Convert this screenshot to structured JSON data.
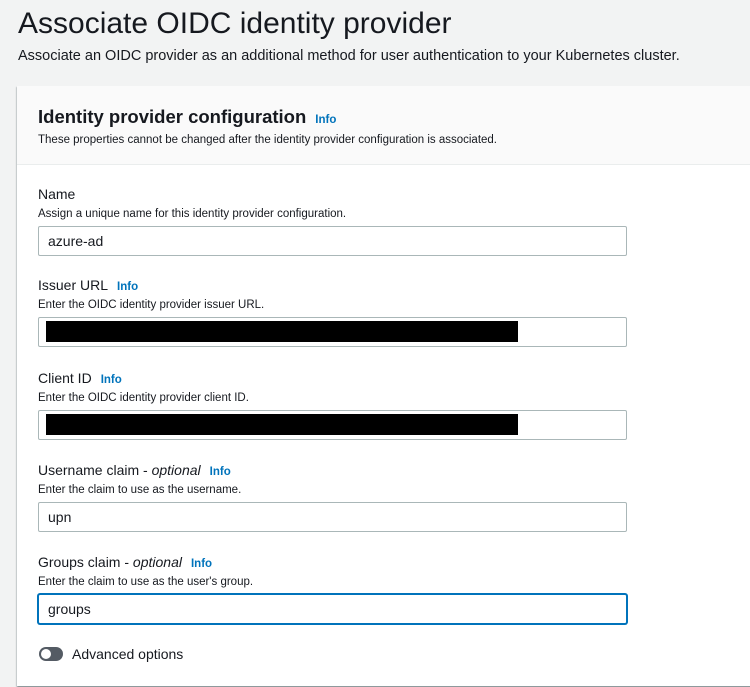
{
  "page": {
    "title": "Associate OIDC identity provider",
    "description": "Associate an OIDC provider as an additional method for user authentication to your Kubernetes cluster."
  },
  "panel": {
    "title": "Identity provider configuration",
    "info_label": "Info",
    "subtitle": "These properties cannot be changed after the identity provider configuration is associated."
  },
  "fields": {
    "name": {
      "label": "Name",
      "description": "Assign a unique name for this identity provider configuration.",
      "value": "azure-ad"
    },
    "issuer_url": {
      "label": "Issuer URL",
      "info_label": "Info",
      "description": "Enter the OIDC identity provider issuer URL.",
      "value": ""
    },
    "client_id": {
      "label": "Client ID",
      "info_label": "Info",
      "description": "Enter the OIDC identity provider client ID.",
      "value": ""
    },
    "username_claim": {
      "label": "Username claim - ",
      "optional": "optional",
      "info_label": "Info",
      "description": "Enter the claim to use as the username.",
      "value": "upn"
    },
    "groups_claim": {
      "label": "Groups claim - ",
      "optional": "optional",
      "info_label": "Info",
      "description": "Enter the claim to use as the user's group.",
      "value": "groups"
    }
  },
  "advanced": {
    "label": "Advanced options",
    "enabled": false
  },
  "colors": {
    "link": "#0073bb",
    "focus_border": "#0073bb",
    "toggle_off": "#545b64",
    "redaction": "#000000"
  }
}
